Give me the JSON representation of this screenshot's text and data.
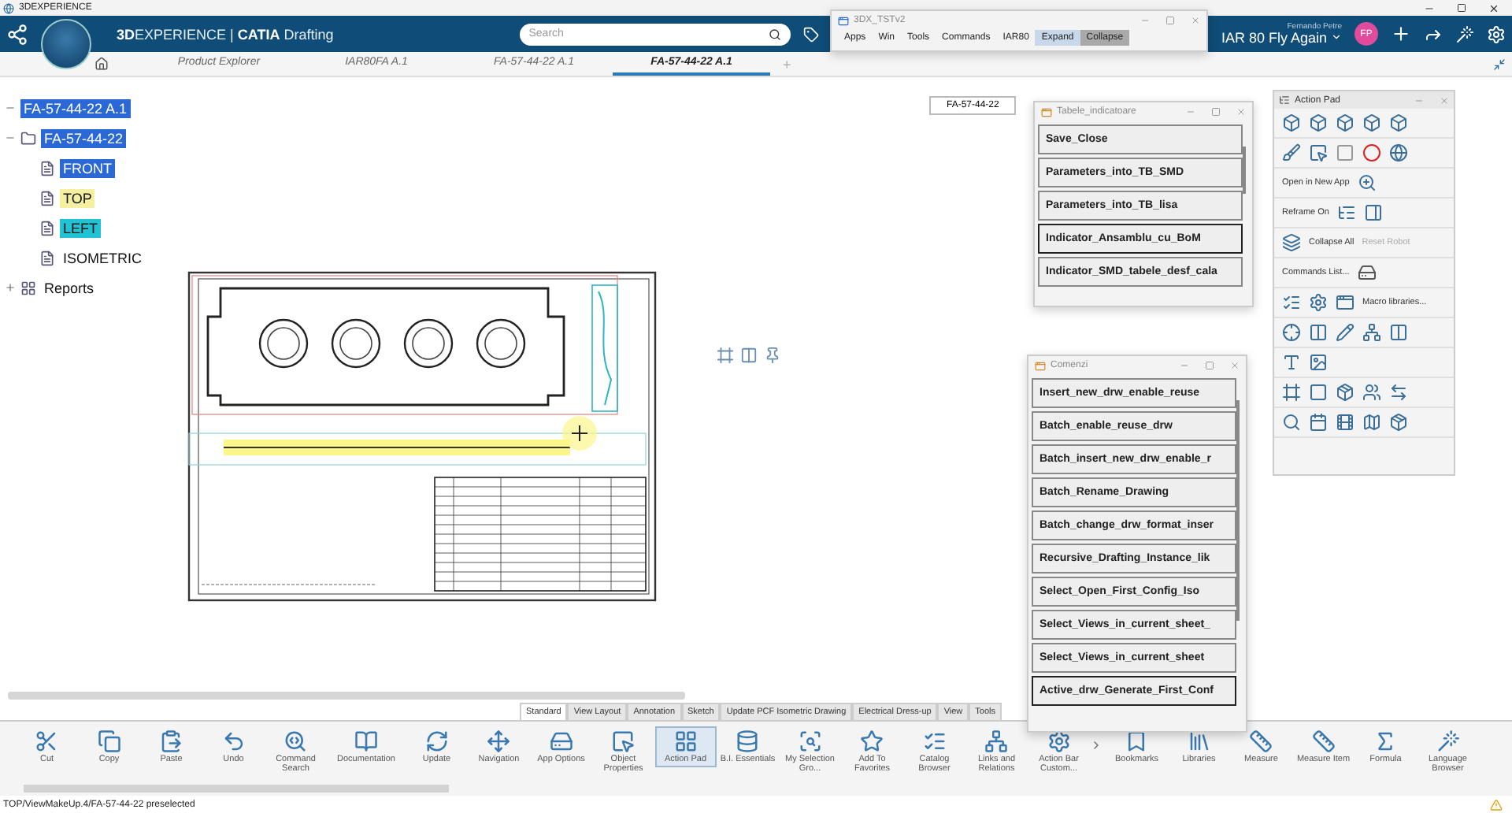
{
  "app_title": "3DEXPERIENCE",
  "header": {
    "brand": "**3D**EXPERIENCE | **CATIA** Drafting",
    "search": {
      "placeholder": "Search"
    },
    "user_name": "Fernando Petre",
    "space": "IAR 80 Fly Again",
    "avatar": "FP"
  },
  "tabs": [
    {
      "label": "Product Explorer",
      "selected": false
    },
    {
      "label": "IAR80FA A.1",
      "selected": false
    },
    {
      "label": "FA-57-44-22 A.1",
      "selected": false
    },
    {
      "label": "FA-57-44-22 A.1",
      "selected": true
    }
  ],
  "add_tab": "+",
  "tree": [
    {
      "label": "FA-57-44-22 A.1",
      "selected": true,
      "expanded": true,
      "children": [
        {
          "label": "FA-57-44-22",
          "selected": true,
          "expanded": true,
          "children": [
            {
              "label": "FRONT",
              "selected": true
            },
            {
              "label": "TOP",
              "selected": false,
              "color": "#f4f0a0"
            },
            {
              "label": "LEFT",
              "selected": false,
              "color": "#1fc3d3"
            },
            {
              "label": "ISOMETRIC",
              "selected": false
            }
          ]
        }
      ]
    },
    {
      "label": "Reports",
      "selected": false,
      "expanded": false
    }
  ],
  "canvas_label": "FA-57-44-22",
  "macro_window": {
    "title": "3DX_TSTv2",
    "menu": [
      {
        "label": "Apps"
      },
      {
        "label": "Win"
      },
      {
        "label": "Tools"
      },
      {
        "label": "Commands"
      },
      {
        "label": "IAR80"
      },
      {
        "label": "Expand",
        "color": "#c7d8ea"
      },
      {
        "label": "Collapse",
        "color": "#a9a9a9"
      }
    ]
  },
  "tabele_window": {
    "title": "Tabele_indicatoare",
    "buttons": [
      {
        "label": "Save_Close",
        "focused": false
      },
      {
        "label": "Parameters_into_TB_SMD",
        "focused": false
      },
      {
        "label": "Parameters_into_TB_lisa",
        "focused": false
      },
      {
        "label": "Indicator_Ansamblu_cu_BoM",
        "focused": true
      },
      {
        "label": "Indicator_SMD_tabele_desf_cala",
        "focused": false
      }
    ]
  },
  "comenzi_window": {
    "title": "Comenzi",
    "buttons": [
      {
        "label": "Insert_new_drw_enable_reuse",
        "focused": false
      },
      {
        "label": "Batch_enable_reuse_drw",
        "focused": false
      },
      {
        "label": "Batch_insert_new_drw_enable_r",
        "focused": false
      },
      {
        "label": "Batch_Rename_Drawing",
        "focused": false
      },
      {
        "label": "Batch_change_drw_format_inser",
        "focused": false
      },
      {
        "label": "Recursive_Drafting_Instance_lik",
        "focused": false
      },
      {
        "label": "Select_Open_First_Config_Iso",
        "focused": false
      },
      {
        "label": "Select_Views_in_current_sheet_",
        "focused": false
      },
      {
        "label": "Select_Views_in_current_sheet",
        "focused": false
      },
      {
        "label": "Active_drw_Generate_First_Conf",
        "focused": true
      }
    ]
  },
  "action_pad": {
    "title": "Action Pad",
    "open_in_new_app": "Open in New App",
    "reframe": "Reframe On",
    "collapse_all": "Collapse All",
    "reset_robot": {
      "label": "Reset Robot",
      "disabled": true
    },
    "commands_list": "Commands List...",
    "macro_libraries": "Macro libraries..."
  },
  "toolbar_tabs": [
    {
      "label": "Standard",
      "selected": true
    },
    {
      "label": "View Layout",
      "selected": false
    },
    {
      "label": "Annotation",
      "selected": false
    },
    {
      "label": "Sketch",
      "selected": false
    },
    {
      "label": "Update PCF Isometric Drawing",
      "selected": false
    },
    {
      "label": "Electrical Dress-up",
      "selected": false
    },
    {
      "label": "View",
      "selected": false
    },
    {
      "label": "Tools",
      "selected": false
    }
  ],
  "toolbar": [
    {
      "label": "Cut"
    },
    {
      "label": "Copy"
    },
    {
      "label": "Paste"
    },
    {
      "label": "Undo"
    },
    {
      "label": "Command Search"
    },
    {
      "label": "Documentation"
    },
    {
      "label": "Update"
    },
    {
      "label": "Navigation"
    },
    {
      "label": "App Options"
    },
    {
      "label": "Object Properties"
    },
    {
      "label": "Action Pad",
      "selected": true
    },
    {
      "label": "B.I. Essentials"
    },
    {
      "label": "My Selection Gro..."
    },
    {
      "label": "Add To Favorites"
    },
    {
      "label": "Catalog Browser"
    },
    {
      "label": "Links and Relations"
    },
    {
      "label": "Action Bar Custom..."
    },
    {
      "label": "Bookmarks"
    },
    {
      "label": "Libraries"
    },
    {
      "label": "Measure"
    },
    {
      "label": "Measure Item"
    },
    {
      "label": "Formula"
    },
    {
      "label": "Language Browser"
    }
  ],
  "status_bar": "TOP/ViewMakeUp.4/FA-57-44-22 preselected"
}
